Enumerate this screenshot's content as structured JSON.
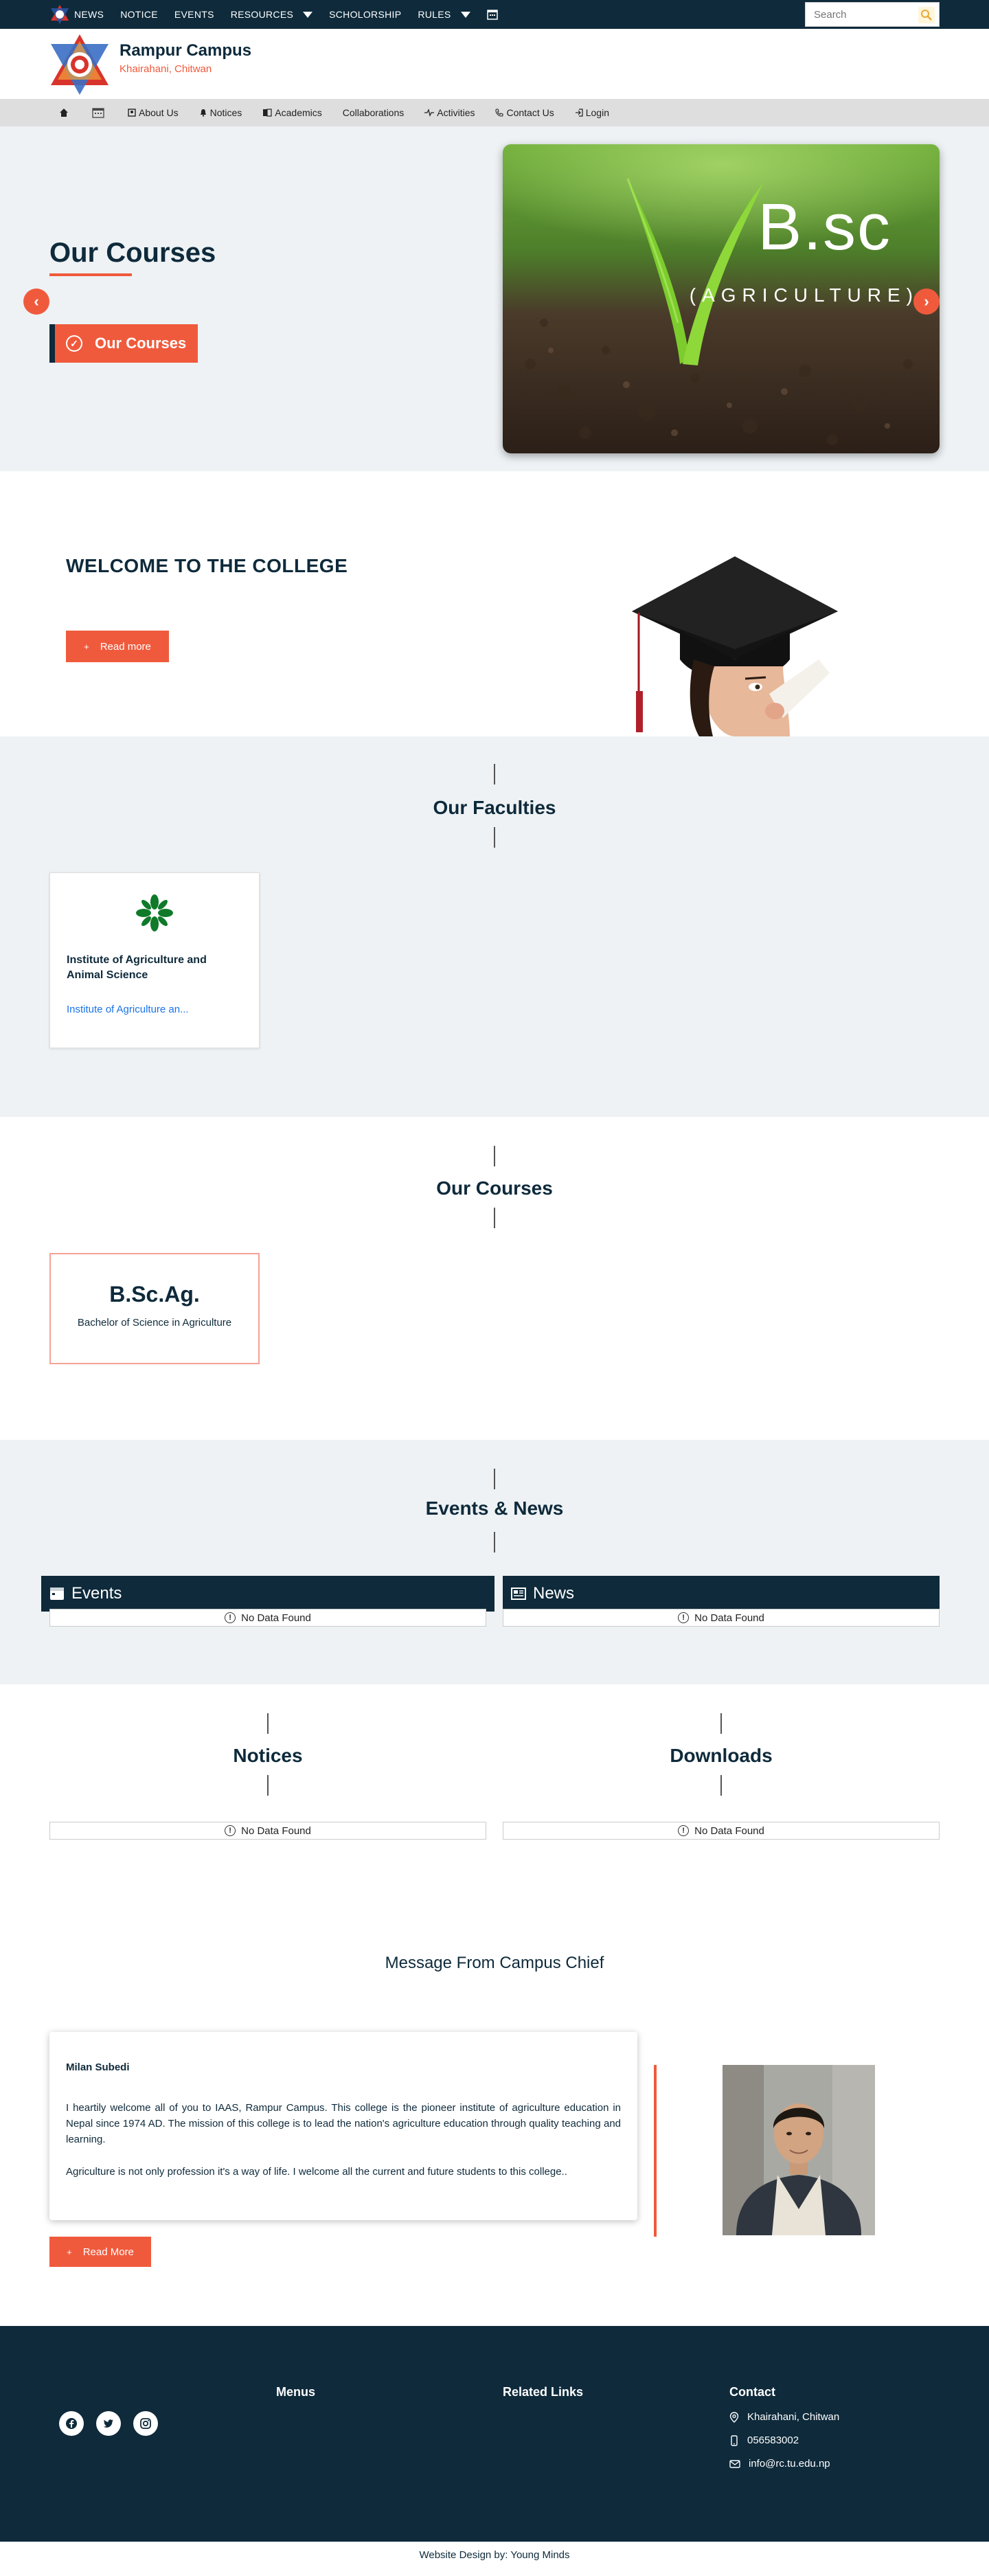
{
  "topbar": {
    "nav": [
      "NEWS",
      "NOTICE",
      "EVENTS",
      "RESOURCES",
      "SCHOLORSHIP",
      "RULES"
    ],
    "search_placeholder": "Search"
  },
  "header": {
    "title": "Rampur Campus",
    "subtitle": "Khairahani, Chitwan"
  },
  "mainnav": {
    "items": [
      "About Us",
      "Notices",
      "Academics",
      "Collaborations",
      "Activities",
      "Contact Us",
      "Login"
    ]
  },
  "hero": {
    "title": "Our Courses",
    "button": "Our Courses",
    "slide_big": "B.sc",
    "slide_small": "(AGRICULTURE)",
    "prev": "‹",
    "next": "›"
  },
  "welcome": {
    "title": "WELCOME TO THE COLLEGE",
    "read_more": "Read more"
  },
  "faculties": {
    "title": "Our Faculties",
    "items": [
      {
        "name": "Institute of Agriculture and Animal Science",
        "link": "Institute of Agriculture an..."
      }
    ]
  },
  "courses": {
    "title": "Our Courses",
    "items": [
      {
        "code": "B.Sc.Ag.",
        "name": "Bachelor of Science in Agriculture"
      }
    ]
  },
  "events_news": {
    "title": "Events & News",
    "events_label": "Events",
    "news_label": "News",
    "no_data": "No Data Found"
  },
  "notices": {
    "title": "Notices",
    "no_data": "No Data Found"
  },
  "downloads": {
    "title": "Downloads",
    "no_data": "No Data Found"
  },
  "message": {
    "title": "Message From Campus Chief",
    "name": "Milan Subedi",
    "para1": "I heartily welcome all of you to IAAS, Rampur Campus. This college is the pioneer institute of agriculture education in Nepal since 1974 AD. The mission of this college is to lead the nation's agriculture education through quality teaching and learning.",
    "para2": "Agriculture is not only profession it's a way of life. I welcome all the current and future students to this college..",
    "read_more": "Read More"
  },
  "footer": {
    "menus": "Menus",
    "related": "Related Links",
    "contact": "Contact",
    "address": "Khairahani, Chitwan",
    "phone": "056583002",
    "email": "info@rc.tu.edu.np",
    "credit": "Website Design by: Young Minds"
  },
  "colors": {
    "navy": "#0e2a3b",
    "accent": "#f05a3c"
  },
  "icons": [
    "home-icon",
    "calendar-icon",
    "bell-icon",
    "book-icon",
    "activity-icon",
    "phone-icon",
    "login-icon",
    "search-icon",
    "facebook-icon",
    "twitter-icon",
    "instagram-icon",
    "location-icon",
    "mobile-icon",
    "mail-icon",
    "info-icon"
  ]
}
